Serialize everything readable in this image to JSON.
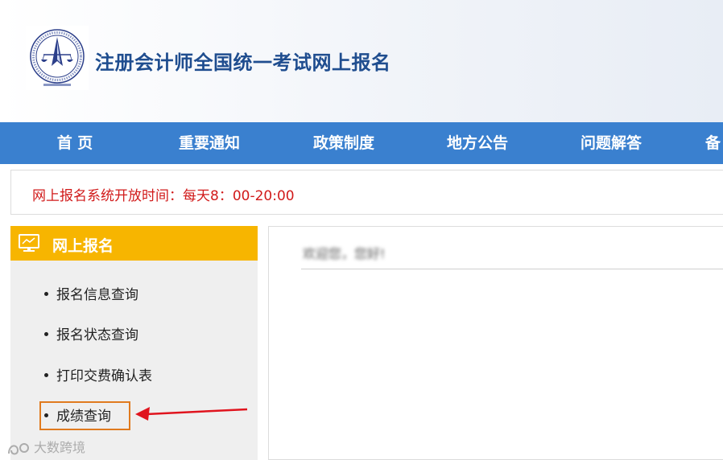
{
  "header": {
    "title": "注册会计师全国统一考试网上报名",
    "logo_icon": "cicpa-logo"
  },
  "nav": {
    "items": [
      {
        "label": "首 页"
      },
      {
        "label": "重要通知"
      },
      {
        "label": "政策制度"
      },
      {
        "label": "地方公告"
      },
      {
        "label": "问题解答"
      },
      {
        "label": "备"
      }
    ]
  },
  "notice": {
    "text": "网上报名系统开放时间：每天8：00-20:00"
  },
  "sidebar": {
    "title": "网上报名",
    "icon": "monitor-icon",
    "items": [
      {
        "label": "报名信息查询"
      },
      {
        "label": "报名状态查询"
      },
      {
        "label": "打印交费确认表"
      },
      {
        "label": "成绩查询"
      }
    ]
  },
  "main": {
    "greeting": "欢迎您，您好!"
  },
  "watermark": {
    "text": "大数跨境"
  },
  "colors": {
    "nav_bg": "#3a80cf",
    "sidebar_head_bg": "#f7b500",
    "notice_text": "#d11a1a",
    "highlight_border": "#e07a1e",
    "arrow": "#e0141e",
    "title": "#1f4d8f"
  }
}
